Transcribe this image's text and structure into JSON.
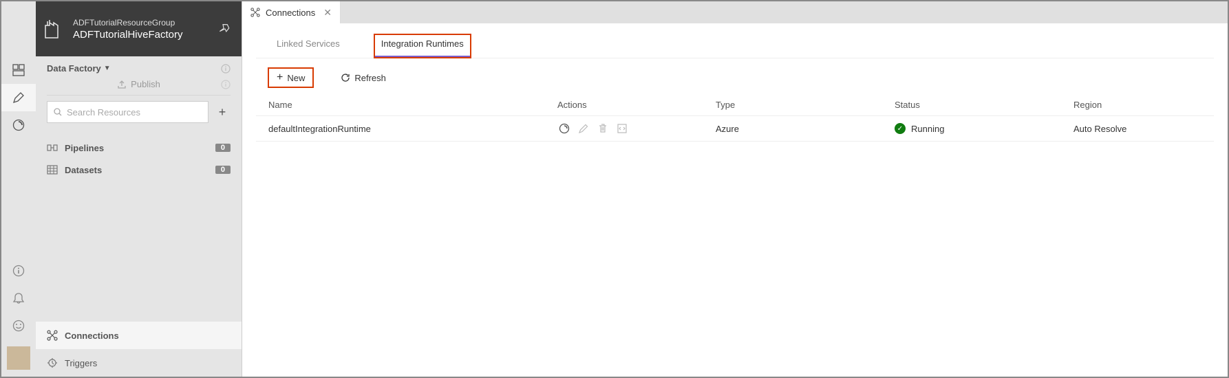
{
  "header": {
    "resource_group": "ADFTutorialResourceGroup",
    "factory_name": "ADFTutorialHiveFactory"
  },
  "sidebar": {
    "section_label": "Data Factory",
    "publish_label": "Publish",
    "search_placeholder": "Search Resources",
    "tree": [
      {
        "label": "Pipelines",
        "count": "0"
      },
      {
        "label": "Datasets",
        "count": "0"
      }
    ],
    "bottom": [
      {
        "label": "Connections",
        "active": true
      },
      {
        "label": "Triggers",
        "active": false
      }
    ]
  },
  "tab": {
    "title": "Connections"
  },
  "sub_tabs": {
    "linked": "Linked Services",
    "ir": "Integration Runtimes"
  },
  "toolbar": {
    "new_label": "New",
    "refresh_label": "Refresh"
  },
  "table": {
    "headers": {
      "name": "Name",
      "actions": "Actions",
      "type": "Type",
      "status": "Status",
      "region": "Region"
    },
    "rows": [
      {
        "name": "defaultIntegrationRuntime",
        "type": "Azure",
        "status": "Running",
        "region": "Auto Resolve"
      }
    ]
  }
}
